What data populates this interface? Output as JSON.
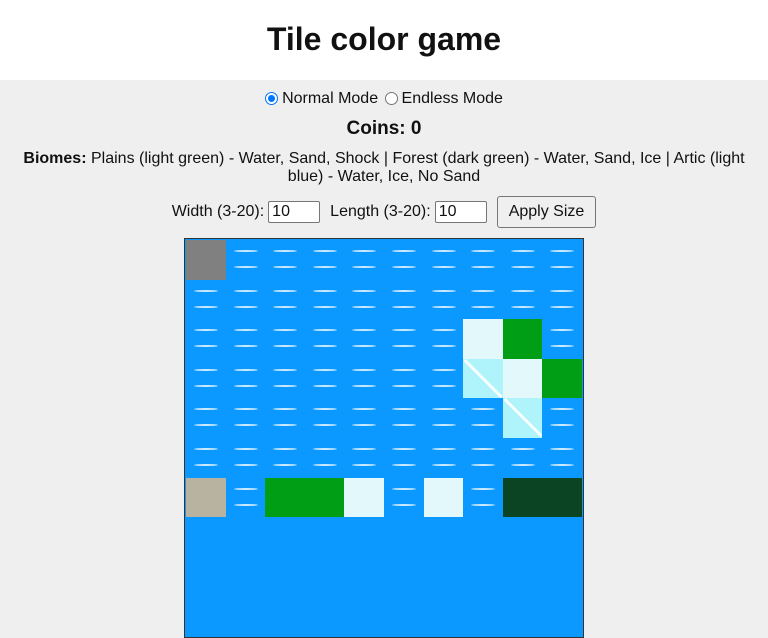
{
  "title": "Tile color game",
  "modes": [
    {
      "label": "Normal Mode",
      "checked": true
    },
    {
      "label": "Endless Mode",
      "checked": false
    }
  ],
  "coins": "Coins: 0",
  "biomes": {
    "label": "Biomes:",
    "text": "Plains (light green) - Water, Sand, Shock | Forest (dark green) - Water, Sand, Ice | Artic (light blue) - Water, Ice, No Sand"
  },
  "size": {
    "width_label": "Width (3-20):",
    "width_value": "10",
    "length_label": "Length (3-20):",
    "length_value": "10",
    "apply_label": "Apply Size"
  },
  "board": {
    "cols": 10,
    "rows": [
      [
        "rock",
        "water",
        "water",
        "water",
        "water",
        "water",
        "water",
        "water",
        "water",
        "water"
      ],
      [
        "water",
        "water",
        "water",
        "water",
        "water",
        "water",
        "water",
        "water",
        "water",
        "water"
      ],
      [
        "water",
        "water",
        "water",
        "water",
        "water",
        "water",
        "water",
        "ice",
        "plains",
        "water"
      ],
      [
        "water",
        "water",
        "water",
        "water",
        "water",
        "water",
        "water",
        "shock",
        "ice",
        "plains"
      ],
      [
        "water",
        "water",
        "water",
        "water",
        "water",
        "water",
        "water",
        "water",
        "shock",
        "water"
      ],
      [
        "water",
        "water",
        "water",
        "water",
        "water",
        "water",
        "water",
        "water",
        "water",
        "water"
      ],
      [
        "sand",
        "water",
        "plains",
        "plains",
        "ice",
        "water",
        "ice",
        "water",
        "forest",
        "forest"
      ]
    ],
    "colors": {
      "water": "#0c99ff",
      "rock": "#808080",
      "ice": "#e2f8fb",
      "shock": "#aff3fb",
      "plains": "#009e15",
      "forest": "#0b4422"
    }
  }
}
